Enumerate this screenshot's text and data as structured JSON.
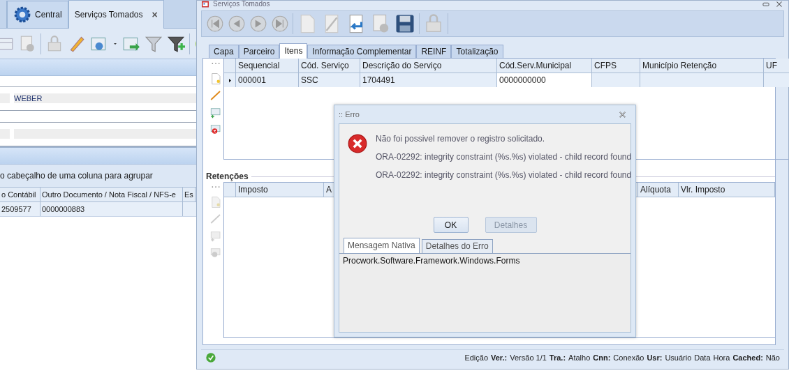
{
  "back_window": {
    "tabs": [
      {
        "label": "Central",
        "selected": false
      },
      {
        "label": "Serviços Tomados",
        "selected": true,
        "close": "×"
      }
    ],
    "field_value": "WEBER",
    "group_hint": "o cabeçalho de uma coluna para agrupar",
    "grid": {
      "columns": [
        "o Contábil",
        "Outro Documento / Nota Fiscal / NFS-e",
        "Es"
      ],
      "rows": [
        [
          "2509577",
          "0000000883"
        ]
      ]
    }
  },
  "main_window": {
    "title": "Serviços Tomados",
    "tabs": [
      {
        "label": "Capa",
        "selected": false
      },
      {
        "label": "Parceiro",
        "selected": false
      },
      {
        "label": "Itens",
        "selected": true
      },
      {
        "label": "Informação Complementar",
        "selected": false
      },
      {
        "label": "REINF",
        "selected": false
      },
      {
        "label": "Totalização",
        "selected": false
      }
    ],
    "items_grid": {
      "columns": [
        "Sequencial",
        "Cód. Serviço",
        "Descrição do Serviço",
        "Cód.Serv.Municipal",
        "CFPS",
        "Município Retenção",
        "UF"
      ],
      "rows": [
        {
          "cells": [
            "000001",
            "SSC",
            "1704491",
            "0000000000"
          ],
          "selected": true
        }
      ]
    },
    "retencoes": {
      "title": "Retenções",
      "columns": [
        "Imposto",
        "A",
        "Alíquota",
        "Vlr. Imposto"
      ]
    },
    "status_bar": [
      {
        "text": "Edição",
        "kind": "value"
      },
      {
        "text": "Ver.:",
        "kind": "key"
      },
      {
        "text": "Versão 1/1",
        "kind": "value"
      },
      {
        "text": "Tra.:",
        "kind": "key"
      },
      {
        "text": "Atalho",
        "kind": "value"
      },
      {
        "text": "Cnn:",
        "kind": "key"
      },
      {
        "text": "Conexão",
        "kind": "value"
      },
      {
        "text": "Usr:",
        "kind": "key"
      },
      {
        "text": "Usuário",
        "kind": "value"
      },
      {
        "text": "Data",
        "kind": "value"
      },
      {
        "text": "Hora",
        "kind": "value"
      },
      {
        "text": "Cached:",
        "kind": "key"
      },
      {
        "text": "Não",
        "kind": "value"
      }
    ]
  },
  "dialog": {
    "title": ":: Erro",
    "messages": [
      "Não foi possivel remover o registro solicitado.",
      "ORA-02292: integrity constraint (%s.%s) violated - child record found",
      "ORA-02292: integrity constraint (%s.%s) violated - child record found"
    ],
    "buttons": [
      {
        "label": "OK",
        "disabled": false
      },
      {
        "label": "Detalhes",
        "disabled": true
      }
    ],
    "tabs": [
      {
        "label": "Mensagem Nativa",
        "selected": true
      },
      {
        "label": "Detalhes do Erro",
        "selected": false
      }
    ],
    "detail_text": "Procwork.Software.Framework.Windows.Forms"
  }
}
